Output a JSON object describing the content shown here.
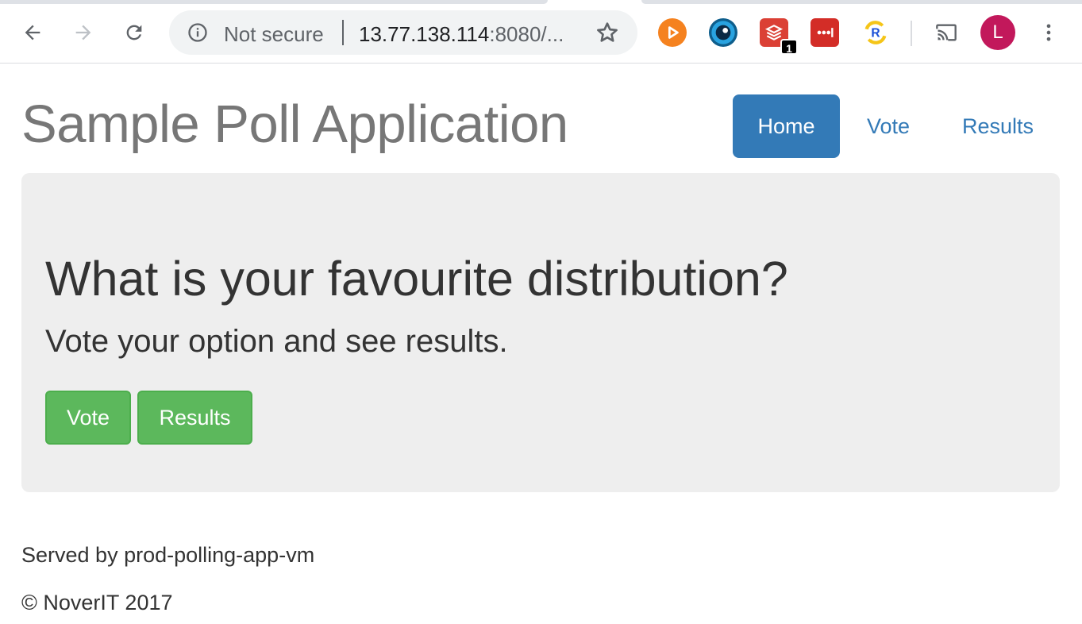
{
  "browser": {
    "security_label": "Not secure",
    "url_host": "13.77.138.114",
    "url_rest": ":8080/...",
    "extensions": [
      {
        "name": "play-extension",
        "color": "#f5821f"
      },
      {
        "name": "eye-extension",
        "color": "#1a8fd1"
      },
      {
        "name": "todoist-extension",
        "color": "#db4035",
        "badge": "1"
      },
      {
        "name": "lastpass-extension",
        "color": "#d32d27"
      },
      {
        "name": "reload-extension",
        "color": "#f5c518"
      }
    ],
    "profile_initial": "L"
  },
  "page": {
    "brand": "Sample Poll Application",
    "nav": [
      {
        "label": "Home",
        "active": true
      },
      {
        "label": "Vote",
        "active": false
      },
      {
        "label": "Results",
        "active": false
      }
    ],
    "jumbotron": {
      "title": "What is your favourite distribution?",
      "lead": "Vote your option and see results.",
      "vote_button": "Vote",
      "results_button": "Results"
    },
    "footer": {
      "served_by": "Served by prod-polling-app-vm",
      "copyright": "© NoverIT 2017"
    }
  },
  "colors": {
    "primary": "#337ab7",
    "success": "#5cb85c",
    "jumbotron_bg": "#eeeeee",
    "brand_text": "#777777"
  }
}
